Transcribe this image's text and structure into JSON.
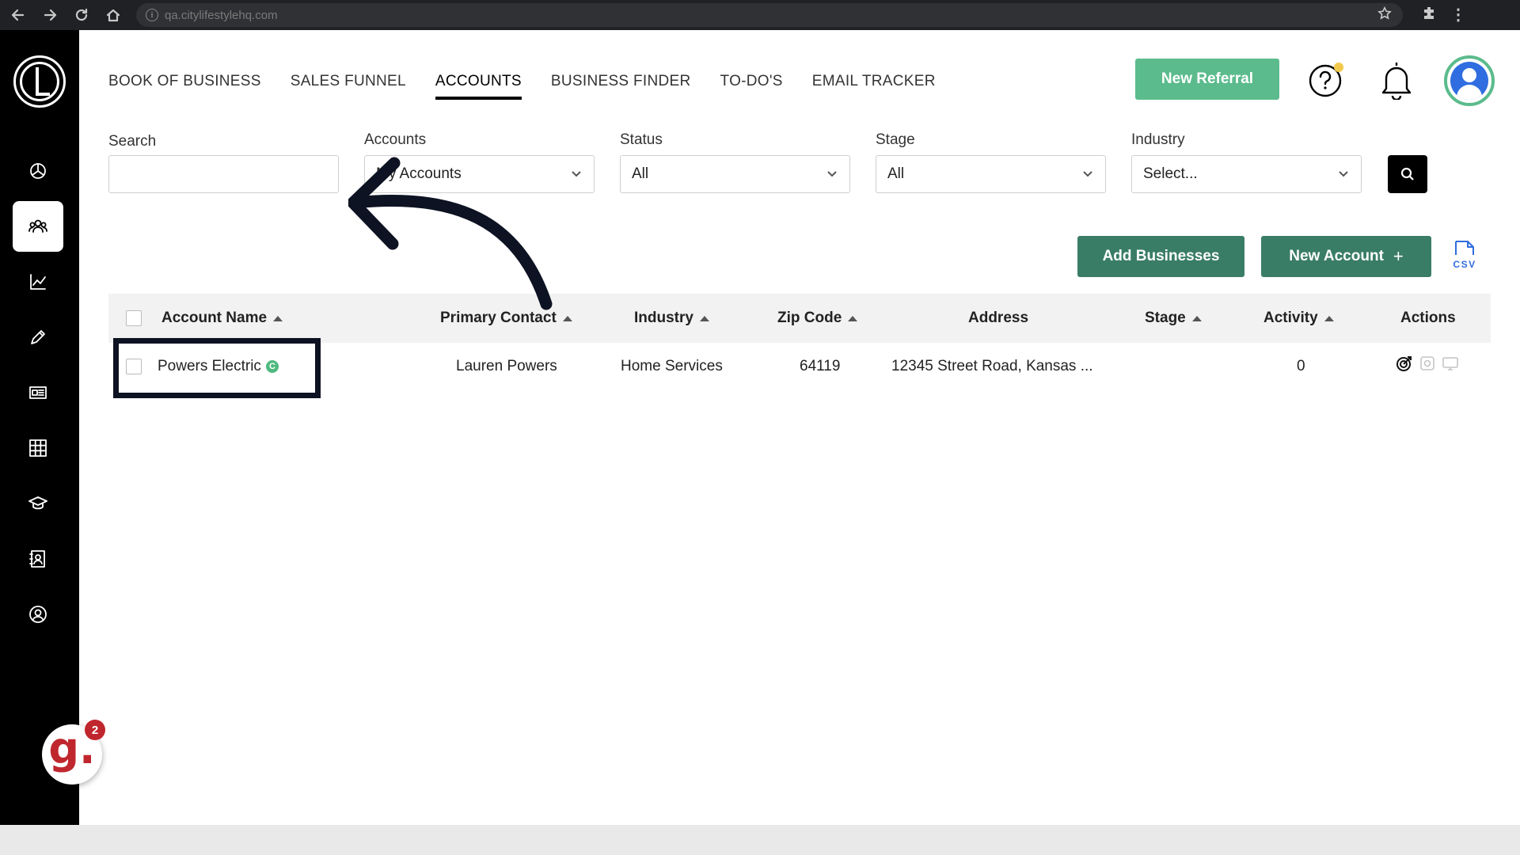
{
  "browser": {
    "url": "qa.citylifestylehq.com"
  },
  "nav": {
    "tabs": [
      {
        "label": "BOOK OF BUSINESS"
      },
      {
        "label": "SALES FUNNEL"
      },
      {
        "label": "ACCOUNTS",
        "active": true
      },
      {
        "label": "BUSINESS FINDER"
      },
      {
        "label": "TO-DO'S"
      },
      {
        "label": "EMAIL TRACKER"
      }
    ],
    "new_referral_label": "New Referral",
    "notification_dot_color": "#f2c94c"
  },
  "filters": {
    "search_label": "Search",
    "search_value": "",
    "accounts_label": "Accounts",
    "accounts_value": "My Accounts",
    "status_label": "Status",
    "status_value": "All",
    "stage_label": "Stage",
    "stage_value": "All",
    "industry_label": "Industry",
    "industry_value": "Select..."
  },
  "actions": {
    "add_businesses_label": "Add Businesses",
    "new_account_label": "New Account",
    "new_account_icon": "+",
    "csv_label": "CSV"
  },
  "table": {
    "headers": {
      "account_name": "Account Name",
      "primary_contact": "Primary Contact",
      "industry": "Industry",
      "zip_code": "Zip Code",
      "address": "Address",
      "stage": "Stage",
      "activity": "Activity",
      "actions": "Actions"
    },
    "rows": [
      {
        "account_name": "Powers Electric",
        "badge": "C",
        "primary_contact": "Lauren Powers",
        "industry": "Home Services",
        "zip_code": "64119",
        "address": "12345 Street Road, Kansas ...",
        "stage": "",
        "activity": "0"
      }
    ]
  },
  "assistant_badge": {
    "letter": "g.",
    "count": "2"
  },
  "colors": {
    "primary_green": "#5bbb8c",
    "dark_green": "#3a7d66",
    "sidebar_bg": "#000000",
    "annotation": "#0d1322"
  }
}
